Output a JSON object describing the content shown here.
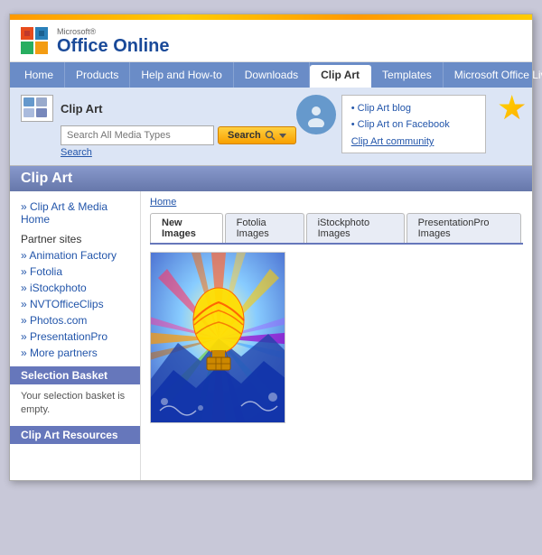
{
  "topBar": {},
  "header": {
    "microsoftLabel": "Microsoft®",
    "officeOnlineLabel": "Office Online"
  },
  "nav": {
    "tabs": [
      {
        "id": "home",
        "label": "Home",
        "active": false
      },
      {
        "id": "products",
        "label": "Products",
        "active": false
      },
      {
        "id": "help",
        "label": "Help and How-to",
        "active": false
      },
      {
        "id": "downloads",
        "label": "Downloads",
        "active": false
      },
      {
        "id": "clipart",
        "label": "Clip Art",
        "active": true
      },
      {
        "id": "templates",
        "label": "Templates",
        "active": false
      },
      {
        "id": "officelive",
        "label": "Microsoft Office Live",
        "active": false
      }
    ]
  },
  "searchArea": {
    "sectionLabel": "Clip Art",
    "inputPlaceholder": "Search All Media Types",
    "searchButtonLabel": "Search",
    "searchLinkLabel": "Search",
    "communityLinks": [
      "Clip Art blog",
      "Clip Art on Facebook"
    ],
    "communityLabel": "Clip Art community"
  },
  "pageTitleBar": {
    "title": "Clip Art"
  },
  "sidebar": {
    "mainLink": "» Clip Art & Media Home",
    "partnerSitesLabel": "Partner sites",
    "partnerLinks": [
      "» Animation Factory",
      "» Fotolia",
      "» iStockphoto",
      "» NVTOfficeClips",
      "» Photos.com",
      "» PresentationPro",
      "» More partners"
    ],
    "selectionBasketTitle": "Selection Basket",
    "selectionBasketText": "Your selection basket is empty.",
    "clipArtResourcesTitle": "Clip Art Resources"
  },
  "mainContent": {
    "breadcrumb": "Home",
    "tabs": [
      {
        "id": "new",
        "label": "New Images",
        "active": true
      },
      {
        "id": "fotolia",
        "label": "Fotolia Images",
        "active": false
      },
      {
        "id": "istockphoto",
        "label": "iStockphoto Images",
        "active": false
      },
      {
        "id": "presentationpro",
        "label": "PresentationPro Images",
        "active": false
      }
    ]
  }
}
